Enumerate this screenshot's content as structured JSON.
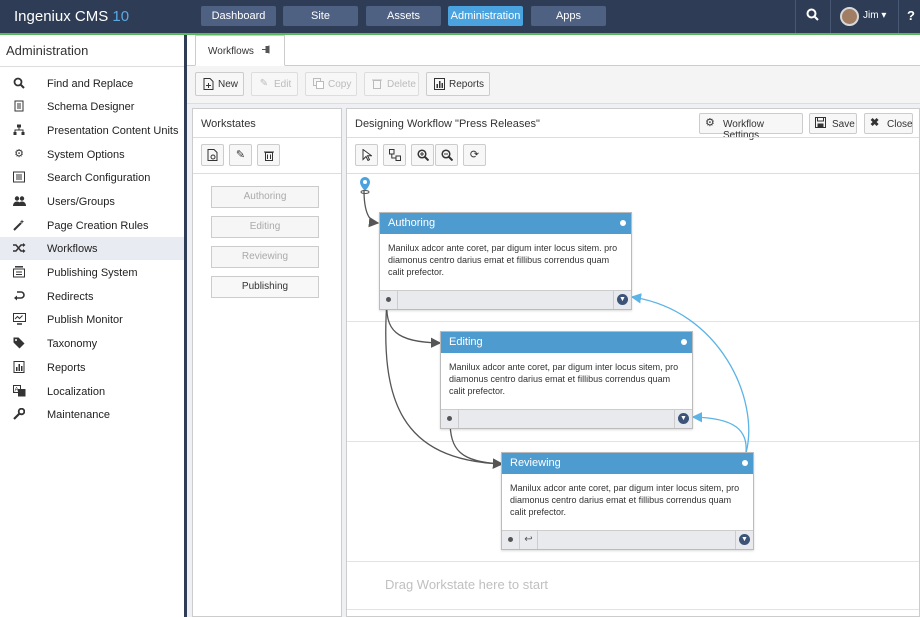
{
  "app": {
    "name": "Ingeniux CMS",
    "version": "10"
  },
  "topnav": {
    "items": [
      {
        "label": "Dashboard",
        "active": false
      },
      {
        "label": "Site",
        "active": false
      },
      {
        "label": "Assets",
        "active": false
      },
      {
        "label": "Administration",
        "active": true
      },
      {
        "label": "Apps",
        "active": false
      }
    ],
    "user": "Jim",
    "help": "?"
  },
  "sidebar": {
    "title": "Administration",
    "items": [
      {
        "label": "Find and Replace",
        "icon": "search-icon"
      },
      {
        "label": "Schema Designer",
        "icon": "schema-icon"
      },
      {
        "label": "Presentation Content Units",
        "icon": "sitemap-icon"
      },
      {
        "label": "System Options",
        "icon": "gears-icon"
      },
      {
        "label": "Search Configuration",
        "icon": "list-icon"
      },
      {
        "label": "Users/Groups",
        "icon": "users-icon"
      },
      {
        "label": "Page Creation Rules",
        "icon": "wand-icon"
      },
      {
        "label": "Workflows",
        "icon": "shuffle-icon",
        "active": true
      },
      {
        "label": "Publishing System",
        "icon": "publish-icon"
      },
      {
        "label": "Redirects",
        "icon": "redirect-icon"
      },
      {
        "label": "Publish Monitor",
        "icon": "monitor-icon"
      },
      {
        "label": "Taxonomy",
        "icon": "tags-icon"
      },
      {
        "label": "Reports",
        "icon": "report-icon"
      },
      {
        "label": "Localization",
        "icon": "translate-icon"
      },
      {
        "label": "Maintenance",
        "icon": "wrench-icon"
      }
    ]
  },
  "tab": {
    "label": "Workflows"
  },
  "toolbar": {
    "new": "New",
    "edit": "Edit",
    "copy": "Copy",
    "delete": "Delete",
    "reports": "Reports"
  },
  "workstates": {
    "title": "Workstates",
    "items": [
      {
        "label": "Authoring",
        "enabled": false
      },
      {
        "label": "Editing",
        "enabled": false
      },
      {
        "label": "Reviewing",
        "enabled": false
      },
      {
        "label": "Publishing",
        "enabled": true
      }
    ]
  },
  "designer": {
    "title": "Designing Workflow \"Press Releases\"",
    "settings": "Workflow Settings",
    "save": "Save",
    "close": "Close",
    "drag_hint": "Drag Workstate here to start",
    "nodes": [
      {
        "name": "Authoring",
        "description": "Manilux adcor ante coret, par digum inter locus sitem. pro diamonus centro darius emat et fillibus correndus quam calit prefector."
      },
      {
        "name": "Editing",
        "description": "Manilux adcor ante coret, par digum inter locus sitem, pro diamonus centro darius emat et fillibus correndus quam calit prefector."
      },
      {
        "name": "Reviewing",
        "description": "Manilux adcor ante coret, par digum inter locus sitem, pro diamonus centro darius emat et fillibus correndus quam calit prefector."
      }
    ]
  },
  "colors": {
    "topbar": "#2e3d55",
    "accent": "#4e9bd0",
    "active_nav": "#4aa3df",
    "green": "#5cb85c",
    "return_wire": "#5bb4e5"
  }
}
